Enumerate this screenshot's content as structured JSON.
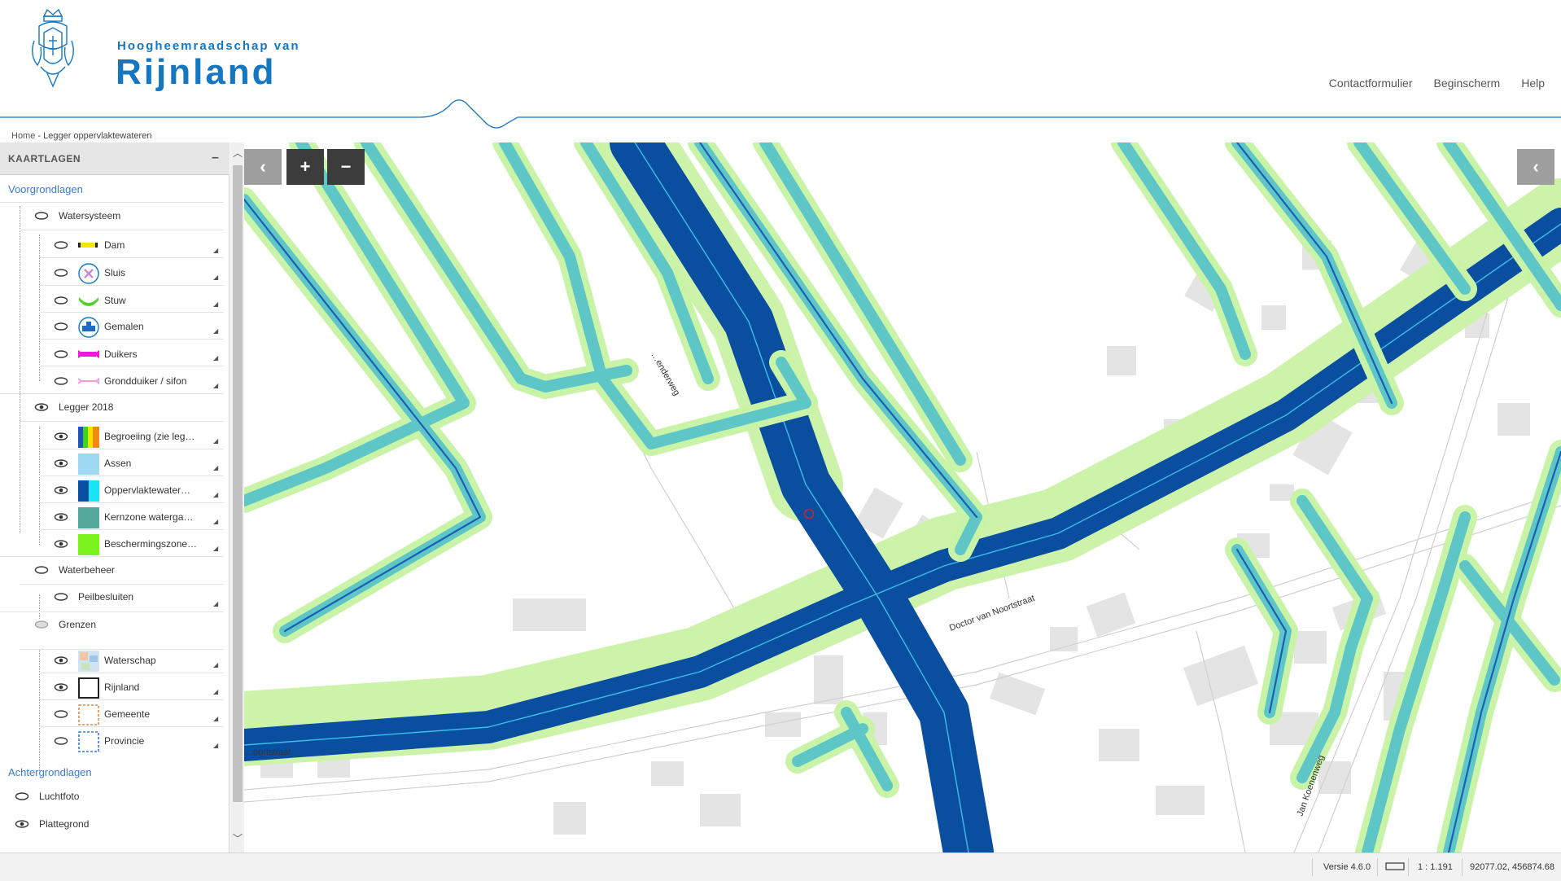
{
  "header": {
    "brand_top": "Hoogheemraadschap van",
    "brand_main": "Rijnland",
    "nav": [
      "Contactformulier",
      "Beginscherm",
      "Help"
    ]
  },
  "breadcrumb": {
    "home": "Home",
    "separator": " - ",
    "current": "Legger oppervlaktewateren"
  },
  "sidebar": {
    "title": "KAARTLAGEN",
    "collapse_icon": "minus-icon",
    "foreground_label": "Voorgrondlagen",
    "background_label": "Achtergrondlagen",
    "groups": [
      {
        "name": "Watersysteem",
        "items": [
          "Dam",
          "Sluis",
          "Stuw",
          "Gemalen",
          "Duikers",
          "Grondduiker / sifon"
        ]
      },
      {
        "name": "Legger 2018",
        "items": [
          "Begroeiing (zie leg…",
          "Assen",
          "Oppervlaktewater…",
          "Kernzone waterga…",
          "Beschermingszone…"
        ]
      },
      {
        "name": "Waterbeheer",
        "items": [
          "Peilbesluiten"
        ]
      },
      {
        "name": "Grenzen",
        "items": [
          "Waterschap",
          "Rijnland",
          "Gemeente",
          "Provincie"
        ]
      }
    ],
    "background_layers": [
      "Luchtfoto",
      "Plattegrond"
    ]
  },
  "map": {
    "controls": {
      "back": "‹",
      "zoom_in": "+",
      "zoom_out": "−",
      "side_toggle": "‹"
    },
    "street_labels": [
      "Doctor van Noortstraat",
      "Jan Koenenweg",
      "…oortstraat",
      "…enderweg"
    ],
    "colors": {
      "water": "#0a4ea0",
      "bank": "#5ec6c7",
      "protection": "#c9f5a6",
      "building": "#e3e3e3"
    }
  },
  "status": {
    "version": "Versie 4.6.0",
    "scale": "1 : 1.191",
    "coords": "92077.02, 456874.68"
  }
}
